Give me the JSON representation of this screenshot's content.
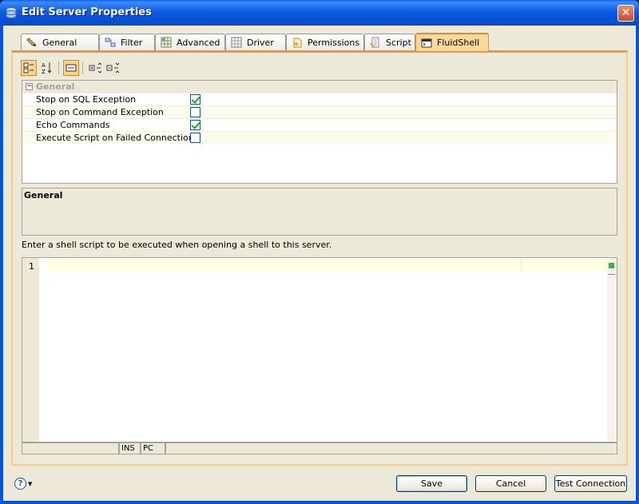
{
  "window": {
    "title": "Edit Server Properties",
    "close_glyph": "✕"
  },
  "tabs": [
    {
      "label": "General",
      "icon": "general-tab-icon"
    },
    {
      "label": "Filter",
      "icon": "filter-tab-icon"
    },
    {
      "label": "Advanced",
      "icon": "advanced-tab-icon"
    },
    {
      "label": "Driver",
      "icon": "driver-tab-icon"
    },
    {
      "label": "Permissions",
      "icon": "permissions-tab-icon"
    },
    {
      "label": "Script",
      "icon": "script-tab-icon"
    },
    {
      "label": "FluidShell",
      "icon": "fluidshell-tab-icon",
      "active": true
    }
  ],
  "properties": {
    "category": "General",
    "category_toggle": "−",
    "rows": [
      {
        "name": "Stop on SQL Exception",
        "checked": true
      },
      {
        "name": "Stop on Command Exception",
        "checked": false
      },
      {
        "name": "Echo Commands",
        "checked": true
      },
      {
        "name": "Execute Script on Failed Connection",
        "checked": false
      }
    ]
  },
  "description": {
    "title": "General"
  },
  "hint": "Enter a shell script to be executed when opening a shell to this server.",
  "editor": {
    "line_number": "1",
    "status_ins": "INS",
    "status_pc": "PC"
  },
  "buttons": {
    "save": "Save",
    "cancel": "Cancel",
    "test": "Test Connection",
    "help": "?"
  },
  "colors": {
    "titlebar": "#0054e3",
    "active_tab": "#fcd89c",
    "checkmark": "#21a121"
  }
}
